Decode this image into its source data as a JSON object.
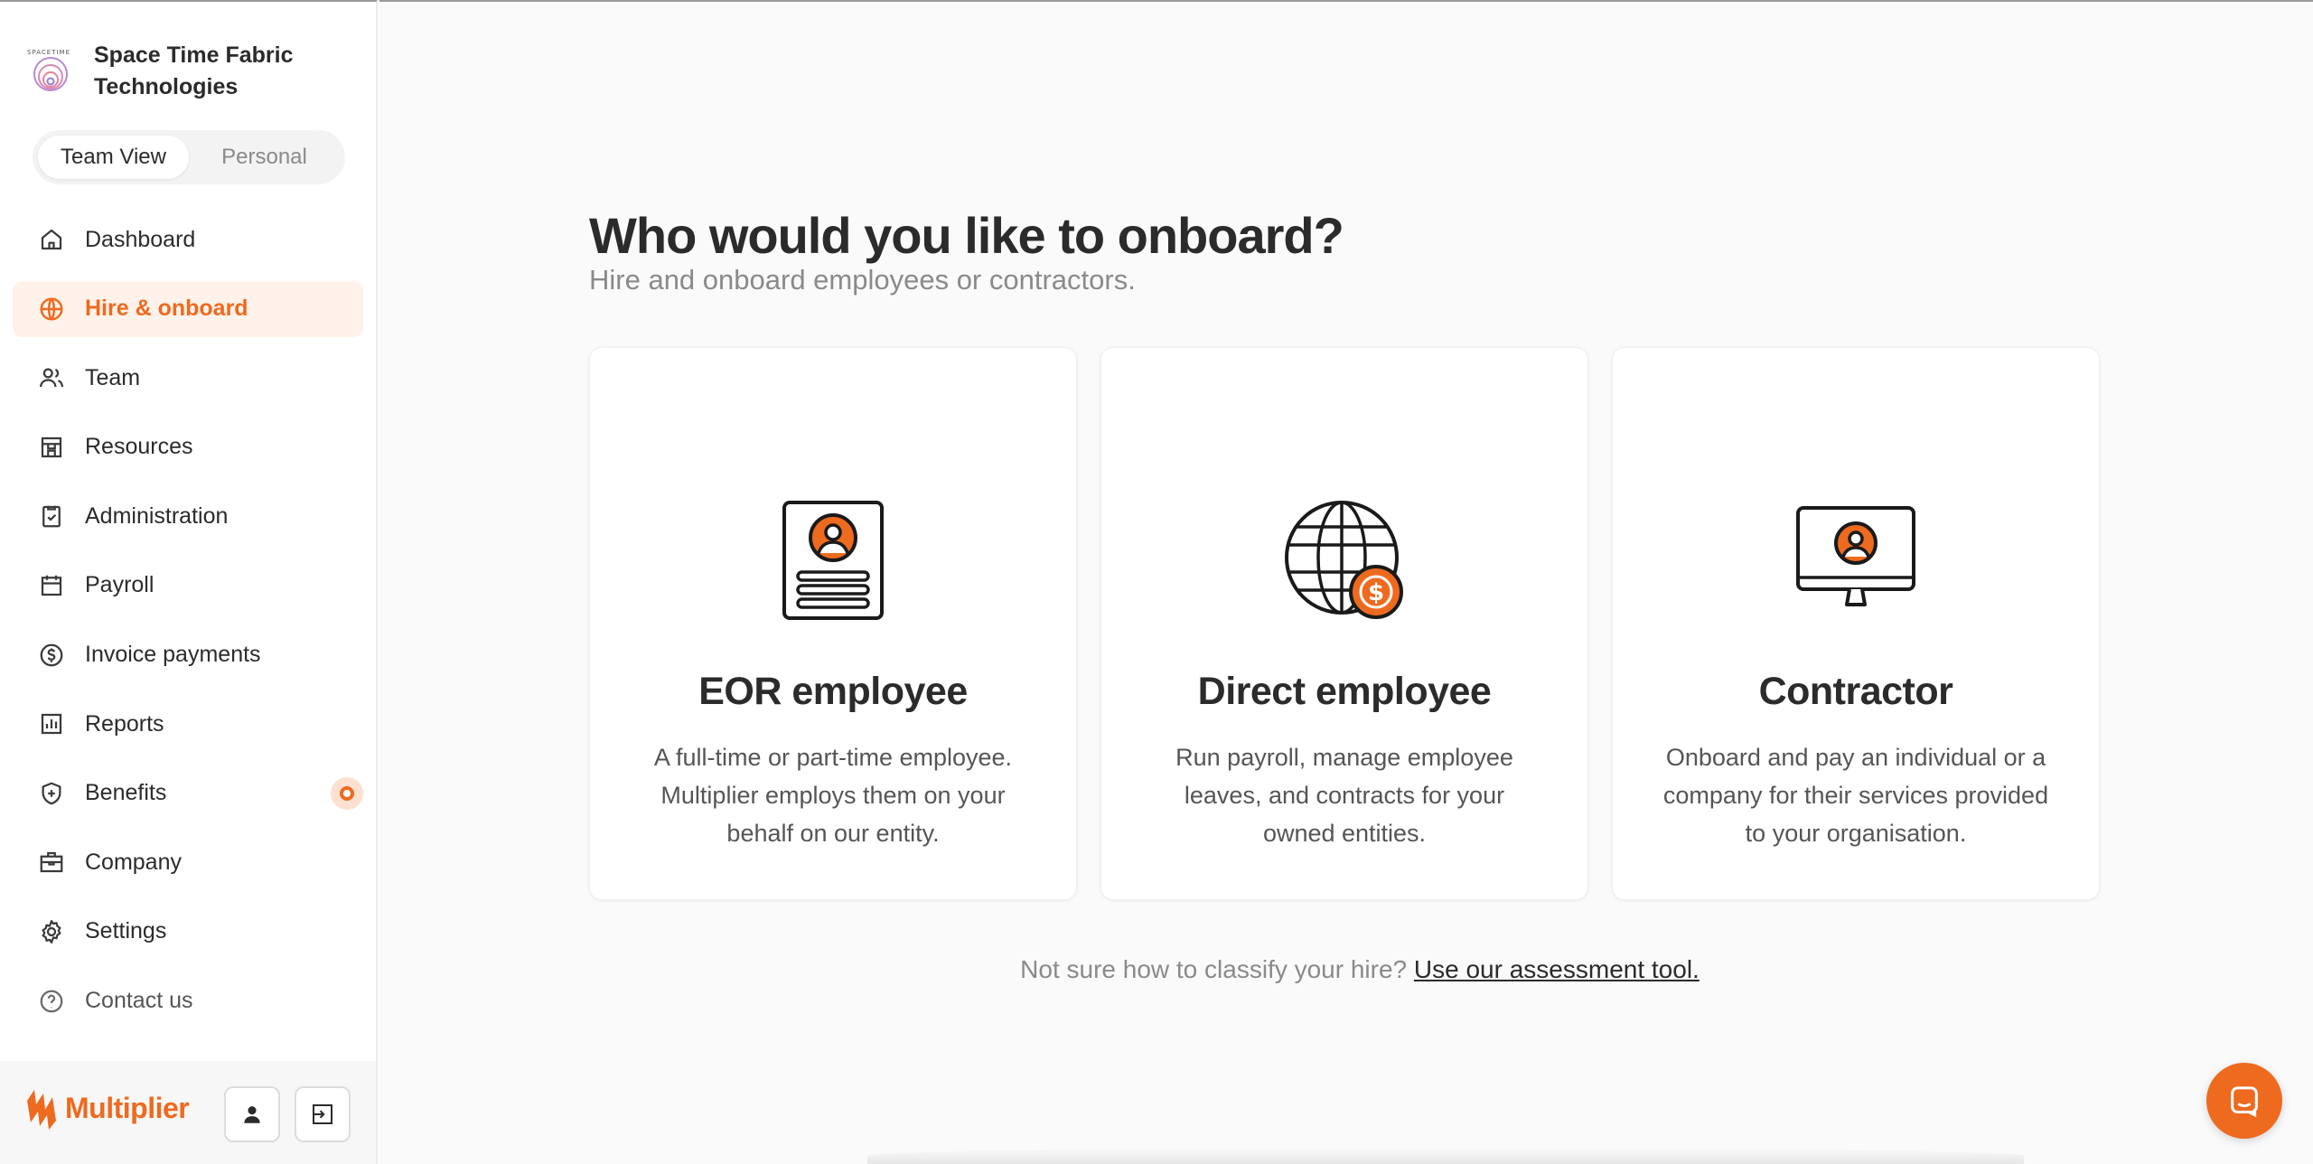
{
  "org": {
    "name": "Space Time Fabric Technologies",
    "logo_text": "SPACETIME"
  },
  "view_toggle": {
    "team": "Team View",
    "personal": "Personal",
    "active": "team"
  },
  "nav": {
    "items": [
      {
        "label": "Dashboard",
        "icon": "home-icon"
      },
      {
        "label": "Hire & onboard",
        "icon": "globe-icon",
        "active": true
      },
      {
        "label": "Team",
        "icon": "users-icon"
      },
      {
        "label": "Resources",
        "icon": "store-icon"
      },
      {
        "label": "Administration",
        "icon": "clipboard-check-icon"
      },
      {
        "label": "Payroll",
        "icon": "calendar-icon"
      },
      {
        "label": "Invoice payments",
        "icon": "dollar-circle-icon"
      },
      {
        "label": "Reports",
        "icon": "bar-chart-icon"
      },
      {
        "label": "Benefits",
        "icon": "shield-plus-icon"
      },
      {
        "label": "Company",
        "icon": "briefcase-icon"
      },
      {
        "label": "Settings",
        "icon": "gear-icon"
      },
      {
        "label": "Contact us",
        "icon": "question-circle-icon"
      }
    ]
  },
  "brand": {
    "name": "Multiplier"
  },
  "main": {
    "title": "Who would you like to onboard?",
    "subtitle": "Hire and onboard employees or contractors.",
    "cards": [
      {
        "title": "EOR employee",
        "description": "A full-time or part-time employee. Multiplier employs them on your behalf on our entity.",
        "icon": "id-card-icon"
      },
      {
        "title": "Direct employee",
        "description": "Run payroll, manage employee leaves, and contracts for your owned entities.",
        "icon": "globe-dollar-icon"
      },
      {
        "title": "Contractor",
        "description": "Onboard and pay an individual or a company for their services provided to your organisation.",
        "icon": "monitor-user-icon"
      }
    ],
    "helper_text": "Not sure how to classify your hire?",
    "helper_link": "Use our assessment tool."
  },
  "colors": {
    "accent": "#ee6a1f",
    "active_bg": "#fff2ea",
    "text": "#2b2b2b",
    "muted": "#8a8a8a"
  }
}
